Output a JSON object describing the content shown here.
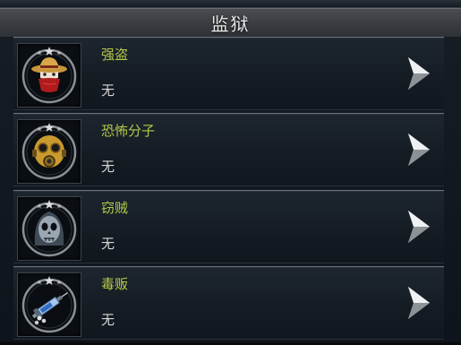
{
  "header": {
    "title": "监狱"
  },
  "rows": [
    {
      "name": "强盗",
      "status": "无",
      "icon": "bandit-cowboy-icon"
    },
    {
      "name": "恐怖分子",
      "status": "无",
      "icon": "gas-mask-icon"
    },
    {
      "name": "窃贼",
      "status": "无",
      "icon": "hooded-skull-icon"
    },
    {
      "name": "毒贩",
      "status": "无",
      "icon": "syringe-pills-icon"
    }
  ],
  "colors": {
    "name_text": "#b5c948",
    "status_text": "#d7d7d7",
    "title_text": "#e8e8e8"
  }
}
